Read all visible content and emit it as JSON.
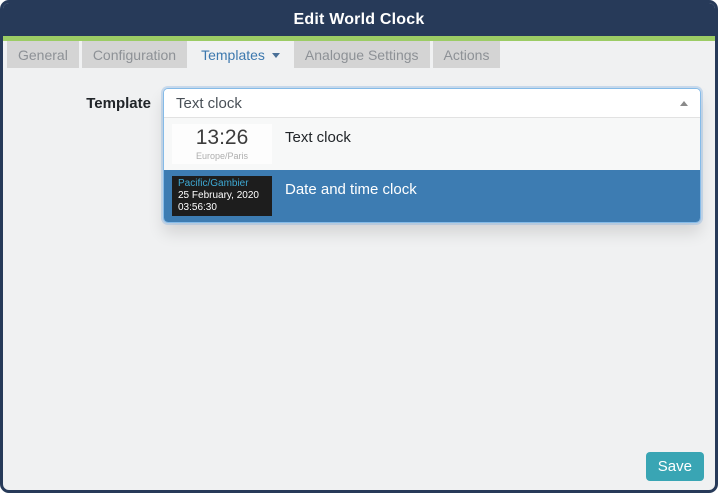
{
  "window": {
    "title": "Edit World Clock"
  },
  "tabs": [
    {
      "label": "General",
      "active": false
    },
    {
      "label": "Configuration",
      "active": false
    },
    {
      "label": "Templates",
      "active": true
    },
    {
      "label": "Analogue Settings",
      "active": false
    },
    {
      "label": "Actions",
      "active": false
    }
  ],
  "form": {
    "template_label": "Template",
    "select": {
      "value": "Text clock",
      "state": "open",
      "caret_icon": "caret-up"
    },
    "dropdown": {
      "options": [
        {
          "label": "Text clock",
          "highlighted": false,
          "preview": {
            "time": "13:26",
            "timezone": "Europe/Paris"
          }
        },
        {
          "label": "Date and time clock",
          "highlighted": true,
          "preview": {
            "timezone": "Pacific/Gambier",
            "date": "25 February, 2020",
            "time": "03:56:30"
          }
        }
      ]
    }
  },
  "footer": {
    "save_label": "Save"
  },
  "colors": {
    "header_navy": "#273a59",
    "accent_green": "#9ccc65",
    "tab_inactive_bg": "#d4d4d4",
    "tab_inactive_text": "#8d9196",
    "active_tab_blue": "#3c78ae",
    "focus_border_blue": "#85bbe8",
    "highlight_option_blue": "#3d7cb2",
    "preview_dark_bg": "#1d1d1d",
    "preview_timezone_cyan": "#3ea9d4",
    "save_teal": "#39a5b4"
  }
}
